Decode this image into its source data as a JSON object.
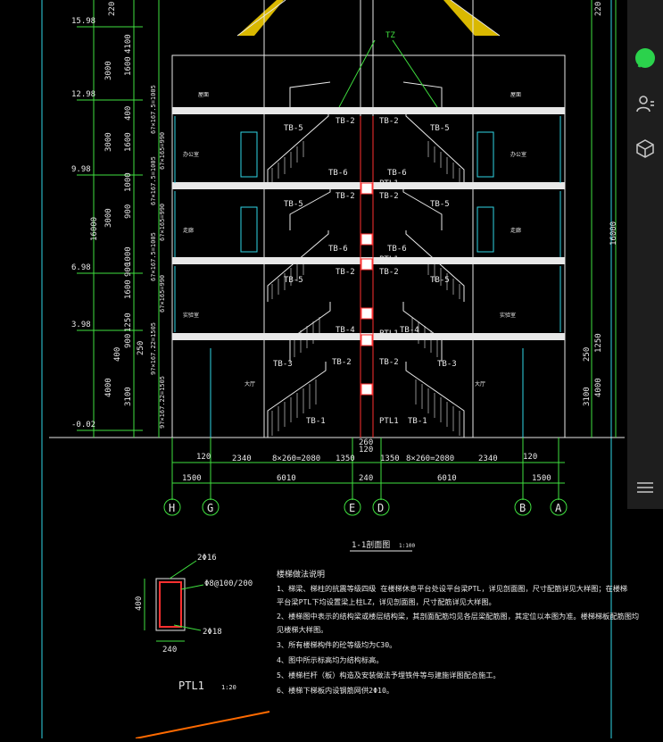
{
  "levels": {
    "roof": "15.98",
    "l4": "12.98",
    "l3": "9.98",
    "l2": "6.98",
    "l1": "3.98",
    "base": "-0.02"
  },
  "left_dims": {
    "top": "220",
    "roof_h": "4100",
    "f4": "3000",
    "f3": "3000",
    "f2": "3000",
    "total": "16000",
    "f1": "4000",
    "r1": "1600",
    "r2": "1600",
    "r3": "1600",
    "t1": "400",
    "t2": "1000",
    "t3": "1000",
    "s1": "900",
    "s2": "900",
    "s3": "900",
    "b1": "3100",
    "b2": "400",
    "b3": "250",
    "b4": "1250"
  },
  "right_dims": {
    "top": "220",
    "total": "16000",
    "f1": "4000",
    "b1": "3100",
    "b2": "250",
    "b3": "1250"
  },
  "stair_notes": [
    "6?×167.5=1005",
    "6?×165=990",
    "6?×167.5=1005",
    "6?×165=990",
    "6?×167.5=1005",
    "6?×165=990",
    "9?×167.22=1505",
    "9?×167.22=1505"
  ],
  "beam_tag": "TZ",
  "stair_labels": {
    "tb1": "TB-1",
    "tb2": "TB-2",
    "tb3": "TB-3",
    "tb4": "TB-4",
    "tb5": "TB-5",
    "tb6": "TB-6",
    "ptl1": "PTL1"
  },
  "room_labels": {
    "roof": "屋面",
    "office": "办公室",
    "corridor": "走廊",
    "hall": "大厅",
    "lab": "实验室"
  },
  "bottom_dims": {
    "d120a": "120",
    "d2340a": "2340",
    "d2080a": "8×260=2080",
    "d1350a": "1350",
    "d120c": "120",
    "d1350b": "1350",
    "d2080b": "8×260=2080",
    "d2340b": "2340",
    "d120b": "120",
    "d260": "260",
    "d1500a": "1500",
    "d6010a": "6010",
    "d240": "240",
    "d6010b": "6010",
    "d1500b": "1500"
  },
  "axes": [
    "H",
    "G",
    "E",
    "D",
    "B",
    "A"
  ],
  "section_title": "1-1剖面图",
  "section_scale": "1:100",
  "ptl": {
    "top_rebar": "2Φ16",
    "stirrup": "Φ8@100/200",
    "bot_rebar": "2Φ18",
    "height": "400",
    "width": "240",
    "title": "PTL1",
    "scale": "1:20"
  },
  "notes": {
    "heading": "楼梯做法说明",
    "lines": [
      "1、梯梁、梯柱的抗震等级四级 在楼梯休息平台处设平台梁PTL，详见剖面图，尺寸配筋详见大样图；在楼梯",
      "平台梁PTL下均设置梁上柱LZ，详见剖面图，尺寸配筋详见大样图。",
      "2、楼梯图中表示的结构梁或楼层结构梁，其剖面配筋均见各层梁配筋图，其定位以本图为准。楼梯梯板配筋图均",
      "见楼梯大样图。",
      "3、所有楼梯构件的砼等级均为C30。",
      "4、图中所示标高均为结构标高。",
      "5、楼梯栏杆（板）构造及安装做法予埋铁件等与建施详图配合施工。",
      "6、楼梯下梯板内设钢筋网供2Φ10。"
    ]
  },
  "colors": {
    "background": "#000000",
    "cad_green": "#3fe03f",
    "cad_white": "#e8e8e8",
    "cad_red": "#ff3030",
    "cad_cyan": "#2fd6e6",
    "cad_yellow": "#ffd800",
    "cad_orange": "#ff6a00",
    "sidebar": "#1e1e1e"
  },
  "sidebar_icons": [
    "avatar-icon",
    "chat-icon",
    "contacts-icon",
    "cube-icon",
    "menu-icon"
  ]
}
